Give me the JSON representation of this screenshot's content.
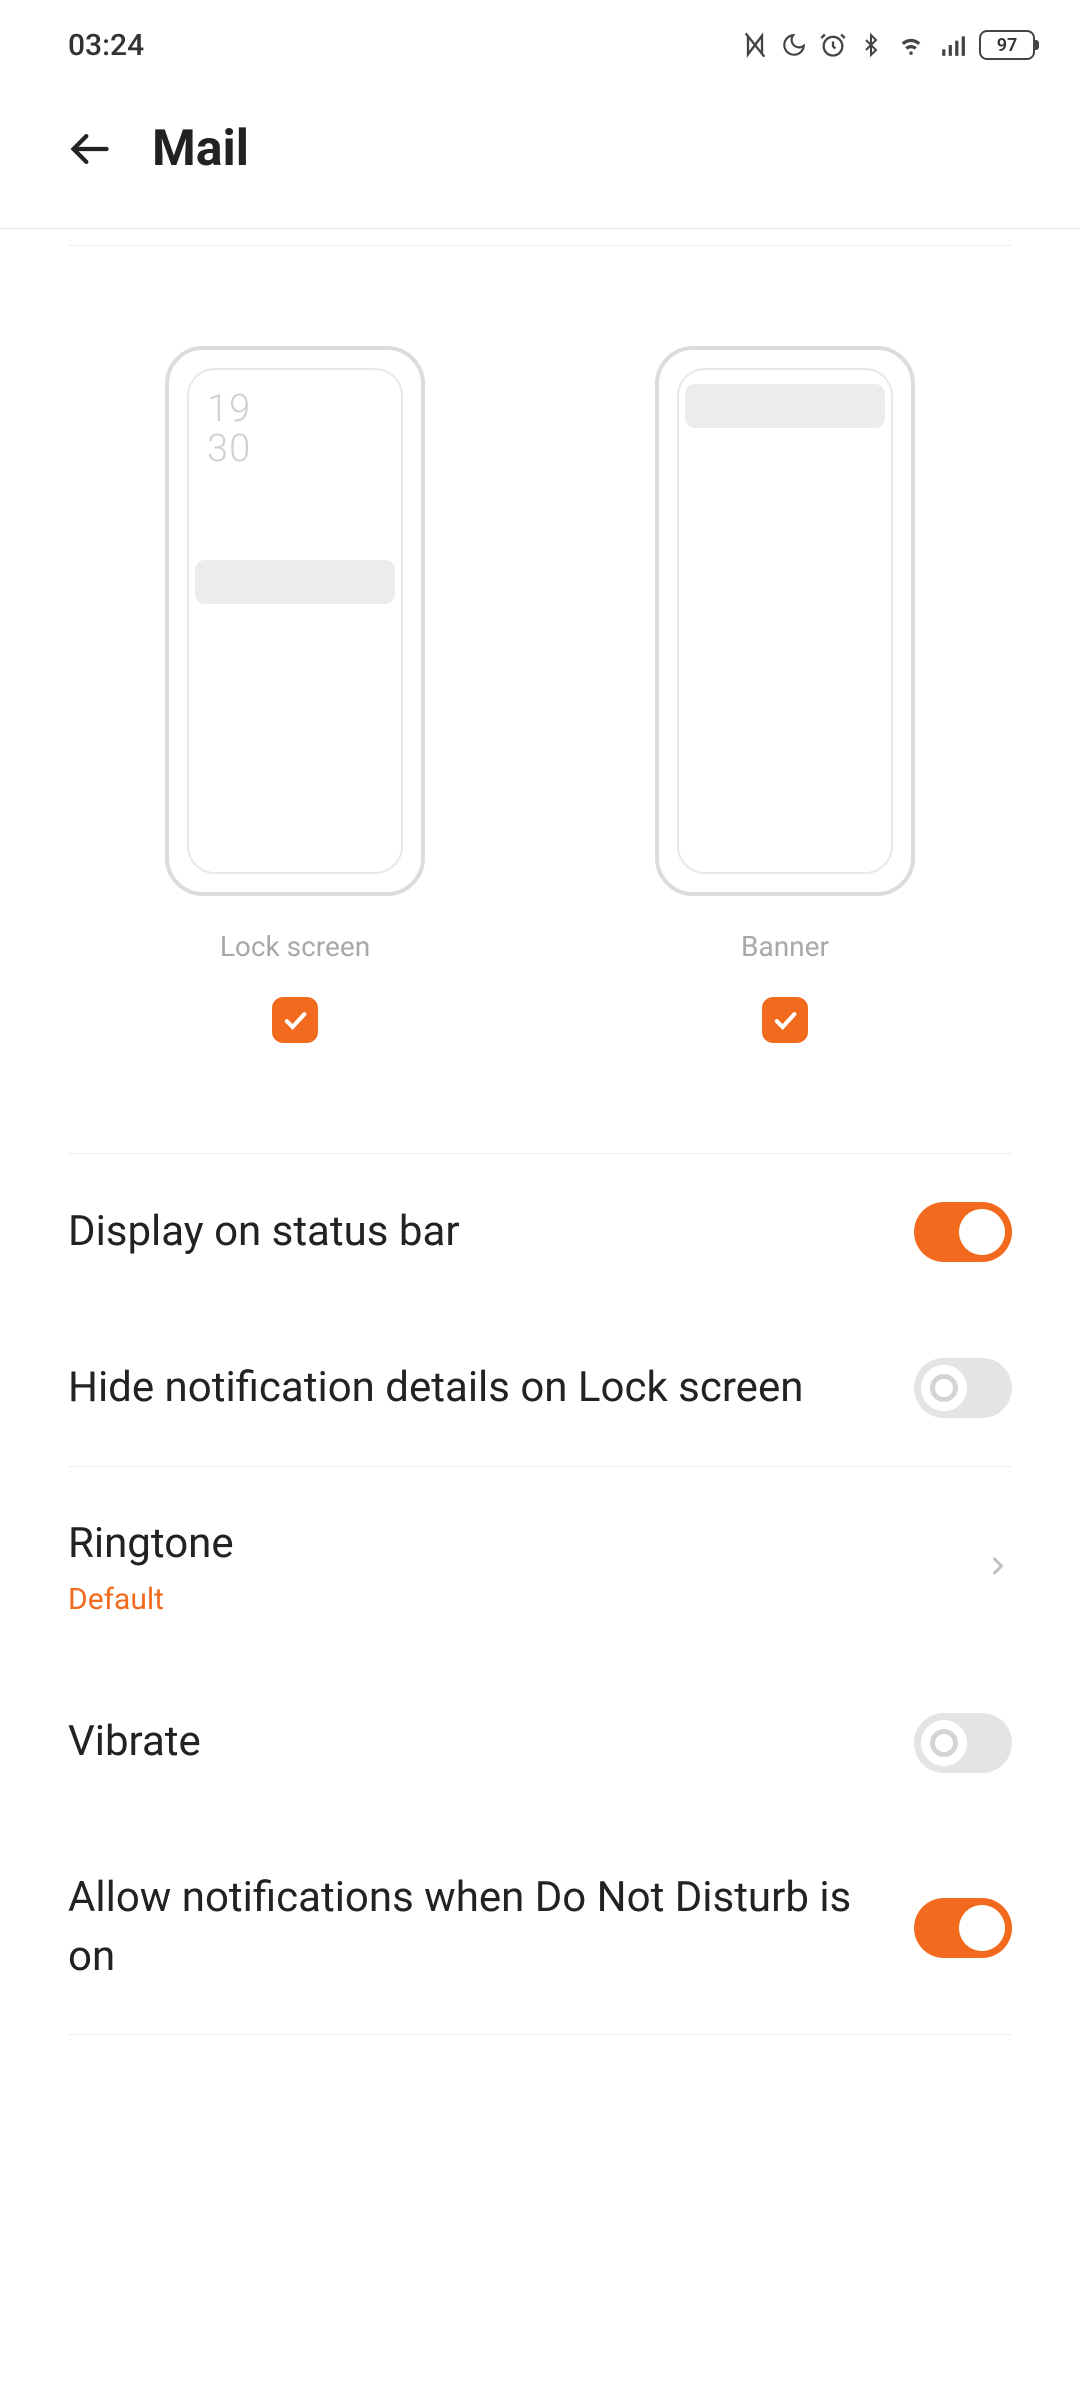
{
  "status": {
    "time": "03:24",
    "battery": "97"
  },
  "header": {
    "title": "Mail"
  },
  "preview": {
    "lock_screen": {
      "label": "Lock screen",
      "time_top": "19",
      "time_bottom": "30",
      "checked": true
    },
    "banner": {
      "label": "Banner",
      "checked": true
    }
  },
  "settings": {
    "display_status_bar": {
      "label": "Display on status bar",
      "on": true
    },
    "hide_details": {
      "label": "Hide notification details on Lock screen",
      "on": false
    },
    "ringtone": {
      "label": "Ringtone",
      "value": "Default"
    },
    "vibrate": {
      "label": "Vibrate",
      "on": false
    },
    "allow_dnd": {
      "label": "Allow notifications when Do Not Disturb is on",
      "on": true
    }
  }
}
